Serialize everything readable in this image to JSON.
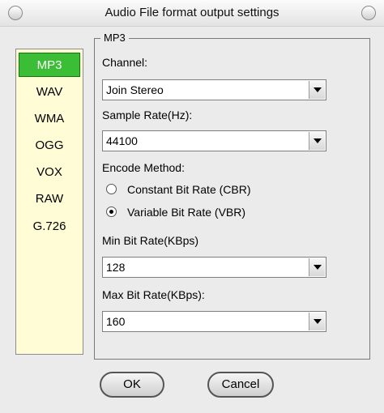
{
  "window": {
    "title": "Audio File format output settings"
  },
  "sidebar": {
    "items": [
      {
        "label": "MP3",
        "selected": true
      },
      {
        "label": "WAV",
        "selected": false
      },
      {
        "label": "WMA",
        "selected": false
      },
      {
        "label": "OGG",
        "selected": false
      },
      {
        "label": "VOX",
        "selected": false
      },
      {
        "label": "RAW",
        "selected": false
      },
      {
        "label": "G.726",
        "selected": false
      }
    ]
  },
  "settings": {
    "group_title": "MP3",
    "channel_label": "Channel:",
    "channel_value": "Join Stereo",
    "sample_rate_label": "Sample Rate(Hz):",
    "sample_rate_value": "44100",
    "encode_method_label": "Encode Method:",
    "encode_options": [
      {
        "label": "Constant Bit Rate (CBR)",
        "checked": false
      },
      {
        "label": "Variable Bit Rate (VBR)",
        "checked": true
      }
    ],
    "min_bitrate_label": "Min Bit Rate(KBps)",
    "min_bitrate_value": "128",
    "max_bitrate_label": "Max Bit Rate(KBps):",
    "max_bitrate_value": "160"
  },
  "buttons": {
    "ok": "OK",
    "cancel": "Cancel"
  },
  "colors": {
    "sidebar_bg": "#fffcd6",
    "selected_bg": "#3bbe35",
    "window_bg": "#ebebeb"
  }
}
